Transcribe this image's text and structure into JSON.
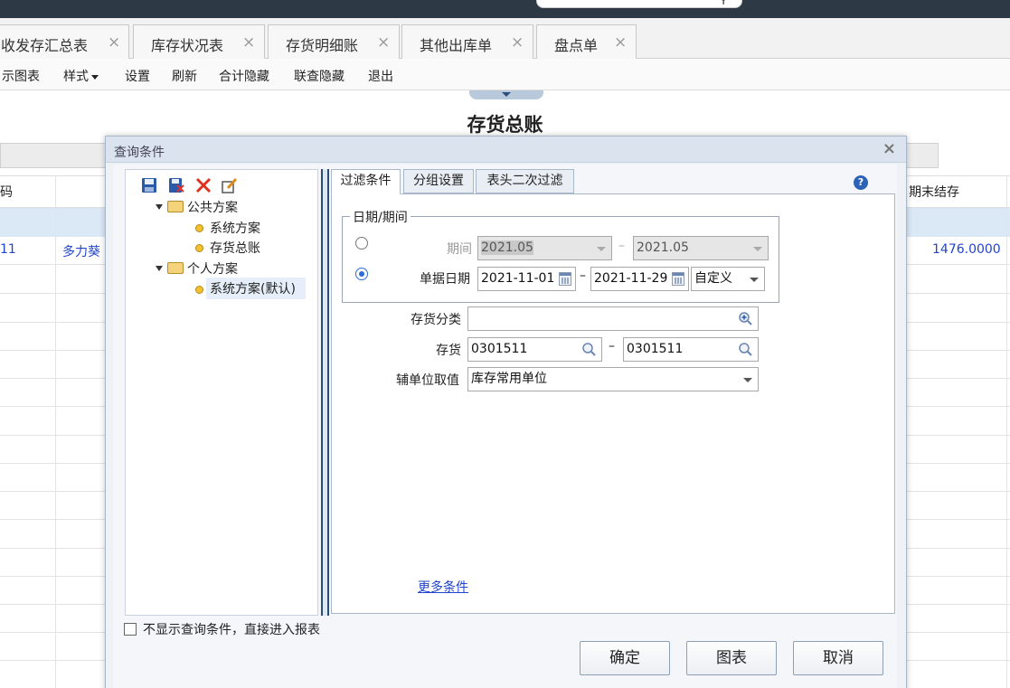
{
  "tabs": [
    {
      "label": "收发存汇总表"
    },
    {
      "label": "库存状况表"
    },
    {
      "label": "存货明细账"
    },
    {
      "label": "其他出库单"
    },
    {
      "label": "盘点单"
    }
  ],
  "toolbar": {
    "items": [
      "示图表",
      "样式",
      "设置",
      "刷新",
      "合计隐藏",
      "联查隐藏",
      "退出"
    ]
  },
  "report": {
    "title": "存货总账",
    "col_left_header": "码",
    "col_right_header": "期末结存",
    "row1_code": "11",
    "row1_name": "多力葵",
    "row1_end_balance": "1476.0000"
  },
  "dialog": {
    "title": "查询条件",
    "tree": {
      "groups": [
        {
          "label": "公共方案",
          "children": [
            "系统方案",
            "存货总账"
          ]
        },
        {
          "label": "个人方案",
          "children": [
            "系统方案(默认)"
          ]
        }
      ]
    },
    "tabs": [
      "过滤条件",
      "分组设置",
      "表头二次过滤"
    ],
    "date_group_legend": "日期/期间",
    "period_label": "期间",
    "period_from": "2021.05",
    "period_to": "2021.05",
    "doc_date_label": "单据日期",
    "doc_date_from": "2021-11-01",
    "doc_date_to": "2021-11-29",
    "date_mode": "自定义",
    "category_label": "存货分类",
    "category_value": "",
    "inventory_label": "存货",
    "inventory_from": "0301511",
    "inventory_to": "0301511",
    "aux_unit_label": "辅单位取值",
    "aux_unit_value": "库存常用单位",
    "more_conditions": "更多条件",
    "skip_checkbox_label": "不显示查询条件，直接进入报表",
    "buttons": {
      "ok": "确定",
      "chart": "图表",
      "cancel": "取消"
    }
  }
}
